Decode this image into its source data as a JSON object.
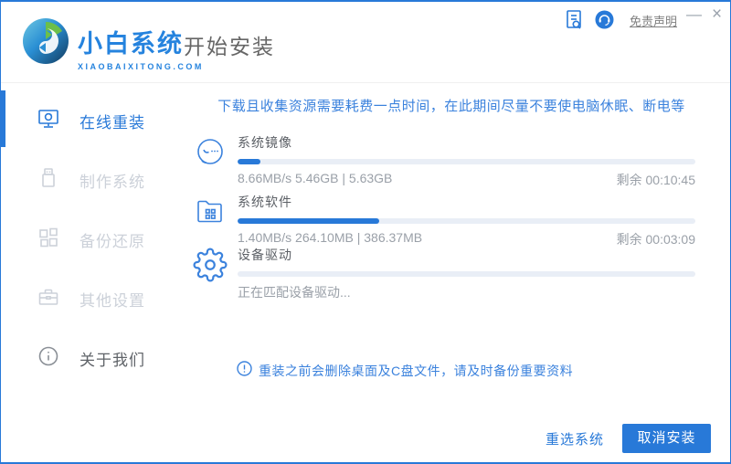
{
  "header": {
    "brand_name": "小白系统",
    "brand_domain": "XIAOBAIXITONG.COM",
    "page_title": "开始安装",
    "disclaimer_link": "免责声明",
    "minimize_label": "—",
    "close_label": "×"
  },
  "sidebar": {
    "items": [
      {
        "label": "在线重装",
        "icon": "monitor-reinstall-icon",
        "active": true
      },
      {
        "label": "制作系统",
        "icon": "usb-drive-icon",
        "active": false
      },
      {
        "label": "备份还原",
        "icon": "backup-blocks-icon",
        "active": false
      },
      {
        "label": "其他设置",
        "icon": "toolbox-icon",
        "active": false
      },
      {
        "label": "关于我们",
        "icon": "info-icon",
        "active": false
      }
    ]
  },
  "main": {
    "warning": "下载且收集资源需要耗费一点时间，在此期间尽量不要使电脑休眠、断电等",
    "tasks": [
      {
        "title": "系统镜像",
        "stats": "8.66MB/s 5.46GB | 5.63GB",
        "remaining": "剩余 00:10:45",
        "progress_percent": 5
      },
      {
        "title": "系统软件",
        "stats": "1.40MB/s 264.10MB | 386.37MB",
        "remaining": "剩余 00:03:09",
        "progress_percent": 31
      },
      {
        "title": "设备驱动",
        "stats": "正在匹配设备驱动...",
        "remaining": "",
        "progress_percent": 0
      }
    ],
    "notice": "重装之前会删除桌面及C盘文件，请及时备份重要资料"
  },
  "footer": {
    "reselect_label": "重选系统",
    "cancel_label": "取消安装"
  },
  "colors": {
    "primary_blue": "#2879d8",
    "track_blue": "#e9eef6",
    "inactive_gray": "#ccd1d9"
  }
}
